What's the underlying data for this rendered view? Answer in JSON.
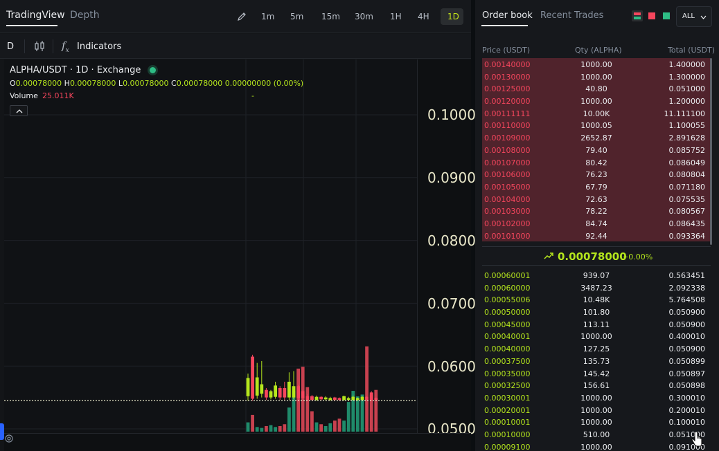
{
  "left_tabs": [
    {
      "label": "TradingView",
      "active": true
    },
    {
      "label": "Depth",
      "active": false
    }
  ],
  "timeframes": [
    {
      "label": "1m",
      "active": false
    },
    {
      "label": "5m",
      "active": false
    },
    {
      "label": "15m",
      "active": false
    },
    {
      "label": "30m",
      "active": false
    },
    {
      "label": "1H",
      "active": false
    },
    {
      "label": "4H",
      "active": false
    },
    {
      "label": "1D",
      "active": true
    }
  ],
  "toolbar": {
    "interval": "D",
    "indicators_label": "Indicators"
  },
  "chart_legend": {
    "title": "ALPHA/USDT · 1D · Exchange",
    "o_key": "O",
    "o_val": "0.00078000",
    "h_key": "H",
    "h_val": "0.00078000",
    "l_key": "L",
    "l_val": "0.00078000",
    "c_key": "C",
    "c_val": "0.00078000",
    "change": "0.00000000 (0.00%)",
    "volume_label": "Volume",
    "volume_value": "25.011K",
    "dash": "-"
  },
  "price_axis_ticks": [
    "0.1000",
    "0.0900",
    "0.0800",
    "0.0700",
    "0.0600",
    "0.0500"
  ],
  "chart_data": {
    "type": "candlestick",
    "y_ticks": [
      0.1,
      0.09,
      0.08,
      0.07,
      0.06,
      0.05
    ],
    "last_price_line": 0.0545,
    "colors": {
      "up": "#b5e61d",
      "down": "#f6465d",
      "vol_up": "#1f8a6a",
      "vol_down": "#c8414f"
    },
    "candles": [
      {
        "dir": "up",
        "o": 0.0552,
        "c": 0.0581,
        "h": 0.0588,
        "l": 0.0545,
        "vol": 0.1
      },
      {
        "dir": "down",
        "o": 0.0615,
        "c": 0.0548,
        "h": 0.0618,
        "l": 0.0545,
        "vol": 0.18
      },
      {
        "dir": "up",
        "o": 0.0553,
        "c": 0.0582,
        "h": 0.0605,
        "l": 0.0548,
        "vol": 0.05
      },
      {
        "dir": "up",
        "o": 0.0556,
        "c": 0.0571,
        "h": 0.0608,
        "l": 0.055,
        "vol": 0.04
      },
      {
        "dir": "down",
        "o": 0.0562,
        "c": 0.055,
        "h": 0.0565,
        "l": 0.0546,
        "vol": 0.06
      },
      {
        "dir": "up",
        "o": 0.055,
        "c": 0.056,
        "h": 0.0562,
        "l": 0.0547,
        "vol": 0.07
      },
      {
        "dir": "up",
        "o": 0.0551,
        "c": 0.0569,
        "h": 0.0575,
        "l": 0.0548,
        "vol": 0.05
      },
      {
        "dir": "down",
        "o": 0.0565,
        "c": 0.055,
        "h": 0.0568,
        "l": 0.0546,
        "vol": 0.06
      },
      {
        "dir": "down",
        "o": 0.0565,
        "c": 0.055,
        "h": 0.0575,
        "l": 0.0546,
        "vol": 0.08
      },
      {
        "dir": "up",
        "o": 0.055,
        "c": 0.0575,
        "h": 0.059,
        "l": 0.0546,
        "vol": 0.26
      },
      {
        "dir": "up",
        "o": 0.055,
        "c": 0.0568,
        "h": 0.0592,
        "l": 0.0547,
        "vol": 0.44
      },
      {
        "dir": "down",
        "o": 0.0568,
        "c": 0.0549,
        "h": 0.057,
        "l": 0.0545,
        "vol": 0.68
      },
      {
        "dir": "down",
        "o": 0.056,
        "c": 0.0549,
        "h": 0.0562,
        "l": 0.0545,
        "vol": 0.7
      },
      {
        "dir": "down",
        "o": 0.0552,
        "c": 0.0546,
        "h": 0.0555,
        "l": 0.0545,
        "vol": 0.48
      },
      {
        "dir": "down",
        "o": 0.0552,
        "c": 0.0546,
        "h": 0.0554,
        "l": 0.0545,
        "vol": 0.22
      },
      {
        "dir": "up",
        "o": 0.0546,
        "c": 0.0551,
        "h": 0.0553,
        "l": 0.0545,
        "vol": 0.1
      },
      {
        "dir": "down",
        "o": 0.0551,
        "c": 0.0547,
        "h": 0.0552,
        "l": 0.0545,
        "vol": 0.08
      },
      {
        "dir": "up",
        "o": 0.0547,
        "c": 0.055,
        "h": 0.0552,
        "l": 0.0545,
        "vol": 0.06
      },
      {
        "dir": "up",
        "o": 0.0546,
        "c": 0.0549,
        "h": 0.0551,
        "l": 0.0545,
        "vol": 0.09
      },
      {
        "dir": "down",
        "o": 0.055,
        "c": 0.0546,
        "h": 0.0551,
        "l": 0.0545,
        "vol": 0.12
      },
      {
        "dir": "down",
        "o": 0.0549,
        "c": 0.0546,
        "h": 0.055,
        "l": 0.0545,
        "vol": 0.14
      },
      {
        "dir": "up",
        "o": 0.0546,
        "c": 0.0552,
        "h": 0.0553,
        "l": 0.0545,
        "vol": 0.12
      },
      {
        "dir": "up",
        "o": 0.0546,
        "c": 0.0549,
        "h": 0.0551,
        "l": 0.0545,
        "vol": 0.32
      },
      {
        "dir": "up",
        "o": 0.0546,
        "c": 0.0551,
        "h": 0.0553,
        "l": 0.0545,
        "vol": 0.44
      },
      {
        "dir": "up",
        "o": 0.0546,
        "c": 0.0549,
        "h": 0.055,
        "l": 0.0545,
        "vol": 0.38
      },
      {
        "dir": "up",
        "o": 0.0546,
        "c": 0.0551,
        "h": 0.0552,
        "l": 0.0545,
        "vol": 0.4
      },
      {
        "dir": "down",
        "o": 0.0551,
        "c": 0.0546,
        "h": 0.0552,
        "l": 0.0545,
        "vol": 0.92
      },
      {
        "dir": "down",
        "o": 0.0558,
        "c": 0.0546,
        "h": 0.056,
        "l": 0.0545,
        "vol": 0.4
      },
      {
        "dir": "down",
        "o": 0.0549,
        "c": 0.0546,
        "h": 0.055,
        "l": 0.0545,
        "vol": 0.45
      }
    ]
  },
  "orderbook_tabs": [
    {
      "label": "Order book",
      "active": true
    },
    {
      "label": "Recent Trades",
      "active": false
    }
  ],
  "depth_filter": "ALL",
  "headers": {
    "price": "Price (USDT)",
    "qty": "Qty (ALPHA)",
    "total": "Total (USDT)"
  },
  "asks": [
    {
      "price": "0.00140000",
      "qty": "1000.00",
      "total": "1.400000"
    },
    {
      "price": "0.00130000",
      "qty": "1000.00",
      "total": "1.300000"
    },
    {
      "price": "0.00125000",
      "qty": "40.80",
      "total": "0.051000"
    },
    {
      "price": "0.00120000",
      "qty": "1000.00",
      "total": "1.200000"
    },
    {
      "price": "0.00111111",
      "qty": "10.00K",
      "total": "11.111100"
    },
    {
      "price": "0.00110000",
      "qty": "1000.05",
      "total": "1.100055"
    },
    {
      "price": "0.00109000",
      "qty": "2652.87",
      "total": "2.891628"
    },
    {
      "price": "0.00108000",
      "qty": "79.40",
      "total": "0.085752"
    },
    {
      "price": "0.00107000",
      "qty": "80.42",
      "total": "0.086049"
    },
    {
      "price": "0.00106000",
      "qty": "76.23",
      "total": "0.080804"
    },
    {
      "price": "0.00105000",
      "qty": "67.79",
      "total": "0.071180"
    },
    {
      "price": "0.00104000",
      "qty": "72.63",
      "total": "0.075535"
    },
    {
      "price": "0.00103000",
      "qty": "78.22",
      "total": "0.080567"
    },
    {
      "price": "0.00102000",
      "qty": "84.74",
      "total": "0.086435"
    },
    {
      "price": "0.00101000",
      "qty": "92.44",
      "total": "0.093364"
    }
  ],
  "mid_price": {
    "value": "0.00078000",
    "change": "+0.00%"
  },
  "bids": [
    {
      "price": "0.00060001",
      "qty": "939.07",
      "total": "0.563451"
    },
    {
      "price": "0.00060000",
      "qty": "3487.23",
      "total": "2.092338"
    },
    {
      "price": "0.00055006",
      "qty": "10.48K",
      "total": "5.764508"
    },
    {
      "price": "0.00050000",
      "qty": "101.80",
      "total": "0.050900"
    },
    {
      "price": "0.00045000",
      "qty": "113.11",
      "total": "0.050900"
    },
    {
      "price": "0.00040001",
      "qty": "1000.00",
      "total": "0.400010"
    },
    {
      "price": "0.00040000",
      "qty": "127.25",
      "total": "0.050900"
    },
    {
      "price": "0.00037500",
      "qty": "135.73",
      "total": "0.050899"
    },
    {
      "price": "0.00035000",
      "qty": "145.42",
      "total": "0.050897"
    },
    {
      "price": "0.00032500",
      "qty": "156.61",
      "total": "0.050898"
    },
    {
      "price": "0.00030001",
      "qty": "1000.00",
      "total": "0.300010"
    },
    {
      "price": "0.00020001",
      "qty": "1000.00",
      "total": "0.200010"
    },
    {
      "price": "0.00010001",
      "qty": "1000.00",
      "total": "0.100010"
    },
    {
      "price": "0.00010000",
      "qty": "510.00",
      "total": "0.051000"
    },
    {
      "price": "0.00009100",
      "qty": "1000.00",
      "total": "0.091000"
    }
  ]
}
